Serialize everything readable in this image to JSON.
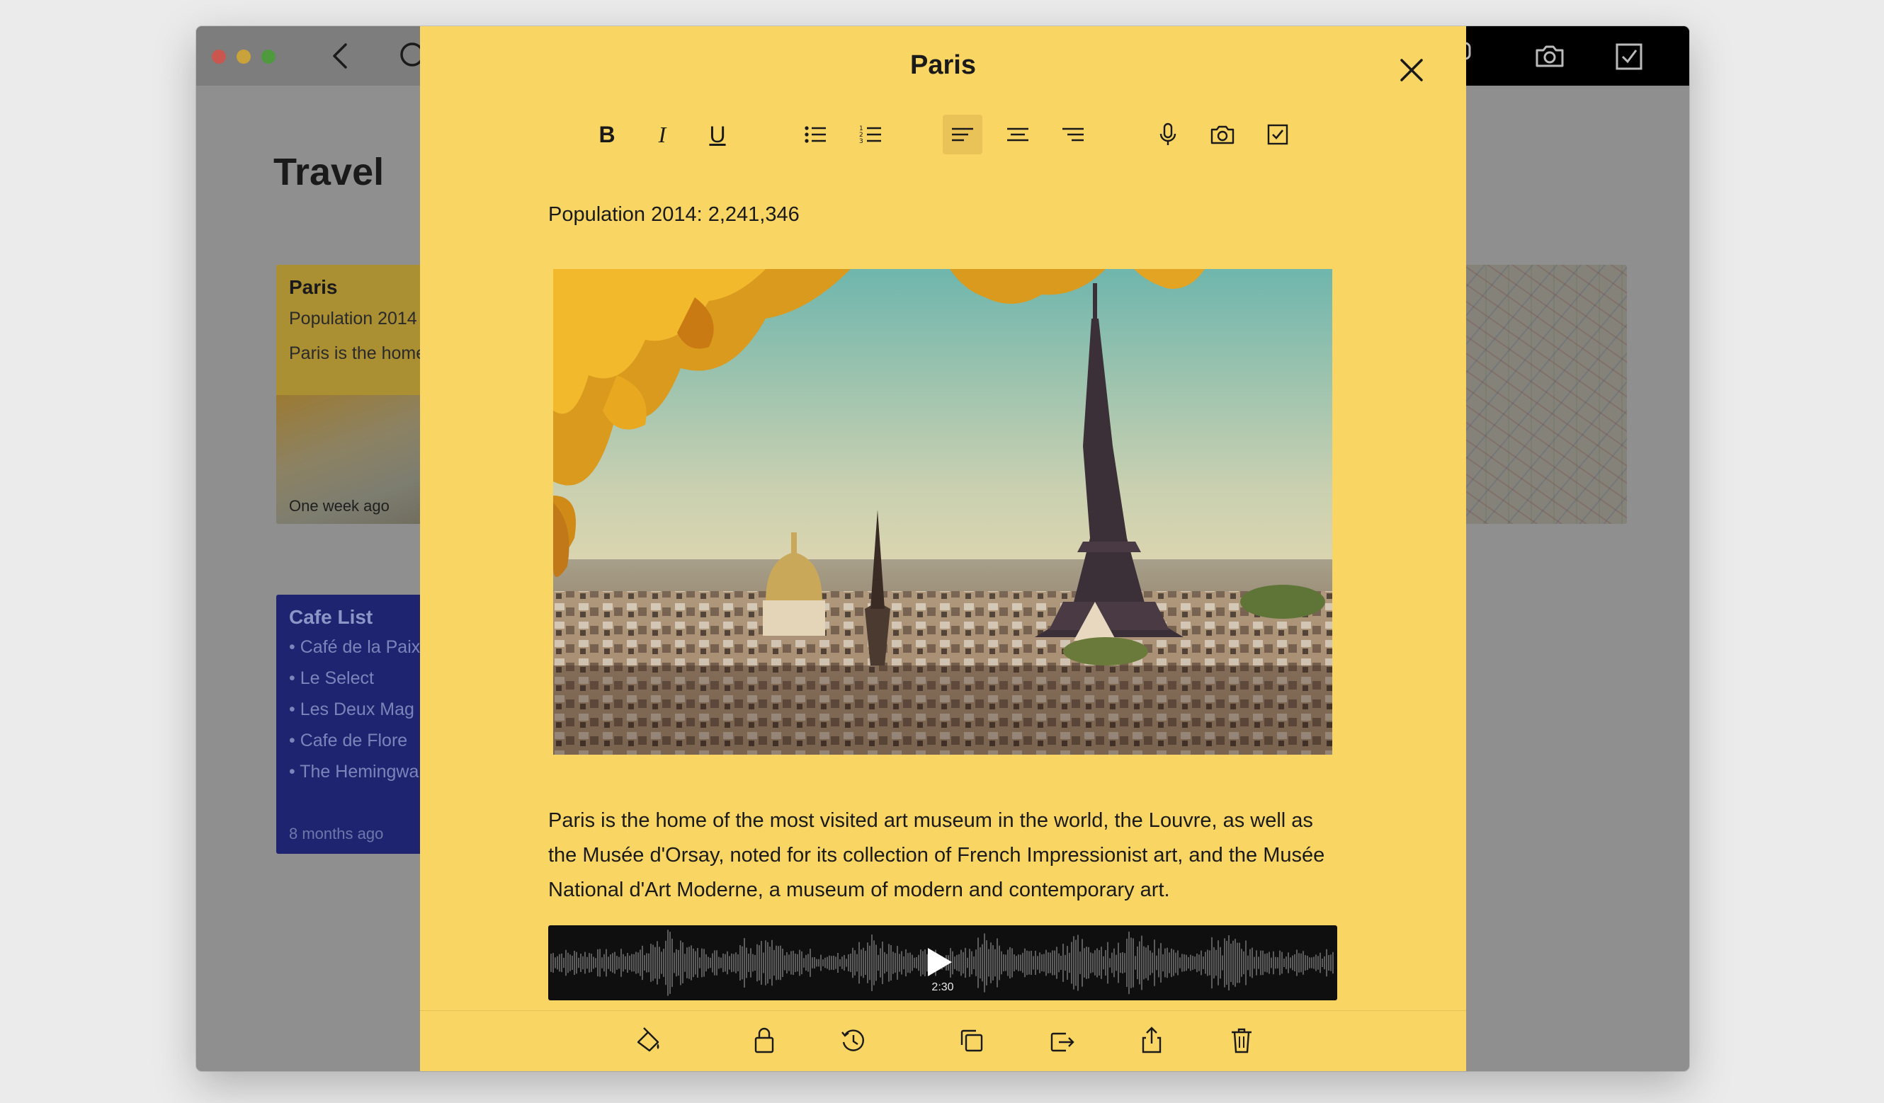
{
  "window": {
    "background_title": "Travel"
  },
  "notes": {
    "paris": {
      "title": "Paris",
      "line1": "Population 2014",
      "line2": "Paris is the home",
      "date": "One week ago"
    },
    "cafe": {
      "title": "Cafe List",
      "items": [
        "Café de la Paix",
        "Le Select",
        "Les Deux Mag",
        "Cafe de Flore",
        "The Hemingwa"
      ],
      "date": "8 months ago"
    }
  },
  "editor": {
    "title": "Paris",
    "population": "Population 2014: 2,241,346",
    "body": "Paris is the home of the most visited art museum in the world, the Louvre, as well as the Musée d'Orsay, noted for its collection of French Impressionist art, and the Musée National d'Art Moderne, a museum of modern and contemporary art.",
    "audio_duration": "2:30",
    "format_toolbar": {
      "bold": "B",
      "italic": "I",
      "underline": "U"
    },
    "active_alignment": "left"
  },
  "colors": {
    "note_yellow": "#f9d564",
    "window_gray": "#8f8f8f",
    "cafe_blue": "#1e2470"
  },
  "icons": [
    "back-icon",
    "search-icon",
    "microphone-icon",
    "camera-icon",
    "checkbox-icon",
    "close-icon",
    "bullet-list-icon",
    "numbered-list-icon",
    "align-left-icon",
    "align-center-icon",
    "align-right-icon",
    "paint-bucket-icon",
    "lock-icon",
    "history-icon",
    "duplicate-icon",
    "move-icon",
    "share-icon",
    "trash-icon",
    "play-icon"
  ]
}
